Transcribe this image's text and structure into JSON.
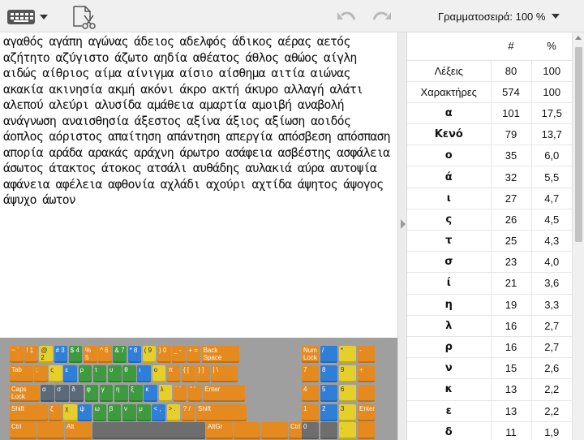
{
  "toolbar": {
    "keyboard_icon": "keyboard-icon",
    "clear_icon": "clear-text-icon",
    "undo_icon": "undo-icon",
    "redo_icon": "redo-icon",
    "font_size_label": "Γραμματοσειρά: 100 %"
  },
  "text": {
    "content": "αγαθός αγάπη αγώνας άδειος αδελφός άδικος αέρας αετός αζήτητο αζύγιστο άζωτο αηδία αθέατος άθλος αθώος αίγλη αιδώς αίθριος αίμα αίνιγμα αίσιο αίσθημα αιτία αιώνας ακακία ακινησία ακμή ακόνι άκρο ακτή άκυρο αλλαγή αλάτι αλεπού αλεύρι αλυσίδα αμάθεια αμαρτία αμοιβή αναβολή ανάγνωση αναισθησία άξεστος αξίνα άξιος αξίωση αοιδός άοπλος αόριστος απαίτηση απάντηση απεργία απόσβεση απόσπαση απορία αράδα αρακάς αράχνη άρωτρο ασάφεια ασβέστης ασφάλεια άσωτος άτακτος άτοκος ατσάλι αυθάδης αυλακιά αύρα αυτοψία αφάνεια αφέλεια αφθονία αχλάδι αχούρι αχτίδα άψητος άψογος άψυχο άωτον"
  },
  "stats": {
    "headers": [
      "",
      "#",
      "%"
    ],
    "rows": [
      {
        "label": "Λέξεις",
        "count": "80",
        "percent": "100"
      },
      {
        "label": "Χαρακτήρες",
        "count": "574",
        "percent": "100"
      },
      {
        "label": "α",
        "count": "101",
        "percent": "17,5"
      },
      {
        "label": "Κενό",
        "count": "79",
        "percent": "13,7"
      },
      {
        "label": "ο",
        "count": "35",
        "percent": "6,0"
      },
      {
        "label": "ά",
        "count": "32",
        "percent": "5,5"
      },
      {
        "label": "ι",
        "count": "27",
        "percent": "4,7"
      },
      {
        "label": "ς",
        "count": "26",
        "percent": "4,5"
      },
      {
        "label": "τ",
        "count": "25",
        "percent": "4,3"
      },
      {
        "label": "σ",
        "count": "23",
        "percent": "4,0"
      },
      {
        "label": "ί",
        "count": "21",
        "percent": "3,6"
      },
      {
        "label": "η",
        "count": "19",
        "percent": "3,3"
      },
      {
        "label": "λ",
        "count": "16",
        "percent": "2,7"
      },
      {
        "label": "ρ",
        "count": "16",
        "percent": "2,7"
      },
      {
        "label": "ν",
        "count": "15",
        "percent": "2,6"
      },
      {
        "label": "κ",
        "count": "13",
        "percent": "2,2"
      },
      {
        "label": "ε",
        "count": "13",
        "percent": "2,2"
      },
      {
        "label": "δ",
        "count": "11",
        "percent": "1,9"
      }
    ]
  },
  "keyboard": {
    "rows": [
      [
        {
          "l": "~ `",
          "c": "orange"
        },
        {
          "l": "! 1",
          "c": "orange"
        },
        {
          "l": "@ 2",
          "c": "yellow"
        },
        {
          "l": "# 3",
          "c": "blue"
        },
        {
          "l": "$ 4",
          "c": "green"
        },
        {
          "l": "% 5",
          "c": "orange"
        },
        {
          "l": "^ 6",
          "c": "orange"
        },
        {
          "l": "& 7",
          "c": "green"
        },
        {
          "l": "* 8",
          "c": "blue"
        },
        {
          "l": "( 9",
          "c": "yellow"
        },
        {
          "l": ") 0",
          "c": "orange"
        },
        {
          "l": "_ -",
          "c": "orange"
        },
        {
          "l": "+ =",
          "c": "orange"
        },
        {
          "l": "Back Space",
          "c": "orange",
          "w": 48
        }
      ],
      [
        {
          "l": "Tab",
          "c": "orange",
          "w": 30
        },
        {
          "l": ";",
          "c": "orange"
        },
        {
          "l": "ς",
          "c": "yellow"
        },
        {
          "l": "ε",
          "c": "blue"
        },
        {
          "l": "ρ",
          "c": "green"
        },
        {
          "l": "τ",
          "c": "green"
        },
        {
          "l": "υ",
          "c": "green"
        },
        {
          "l": "θ",
          "c": "green"
        },
        {
          "l": "ι",
          "c": "blue"
        },
        {
          "l": "ο",
          "c": "yellow"
        },
        {
          "l": "π",
          "c": "orange"
        },
        {
          "l": "{ [",
          "c": "orange"
        },
        {
          "l": "} ]",
          "c": "orange"
        },
        {
          "l": "| \\",
          "c": "orange",
          "w": 34
        }
      ],
      [
        {
          "l": "Caps Lock",
          "c": "orange",
          "w": 38
        },
        {
          "l": "α",
          "c": "shade"
        },
        {
          "l": "σ",
          "c": "shade"
        },
        {
          "l": "δ",
          "c": "shade"
        },
        {
          "l": "φ",
          "c": "green"
        },
        {
          "l": "γ",
          "c": "green"
        },
        {
          "l": "η",
          "c": "green"
        },
        {
          "l": "ξ",
          "c": "green"
        },
        {
          "l": "κ",
          "c": "blue"
        },
        {
          "l": "λ",
          "c": "yellow"
        },
        {
          "l": "΄ ¨",
          "c": "orange"
        },
        {
          "l": "\" '",
          "c": "orange"
        },
        {
          "l": "Enter",
          "c": "orange",
          "w": 53
        }
      ],
      [
        {
          "l": "Shift",
          "c": "orange",
          "w": 48
        },
        {
          "l": "ζ",
          "c": "orange"
        },
        {
          "l": "χ",
          "c": "yellow"
        },
        {
          "l": "ψ",
          "c": "blue"
        },
        {
          "l": "ω",
          "c": "green"
        },
        {
          "l": "β",
          "c": "green"
        },
        {
          "l": "ν",
          "c": "green"
        },
        {
          "l": "μ",
          "c": "green"
        },
        {
          "l": "< ,",
          "c": "blue"
        },
        {
          "l": "> .",
          "c": "yellow"
        },
        {
          "l": "? /",
          "c": "orange"
        },
        {
          "l": "Shift",
          "c": "orange",
          "w": 63
        }
      ],
      [
        {
          "l": "Ctrl",
          "c": "orange",
          "w": 34
        },
        {
          "l": "",
          "c": "orange",
          "w": 34
        },
        {
          "l": "Alt",
          "c": "orange",
          "w": 34
        },
        {
          "l": "",
          "c": "grey",
          "w": 140
        },
        {
          "l": "AltGr",
          "c": "orange",
          "w": 34
        },
        {
          "l": "",
          "c": "orange",
          "w": 34
        },
        {
          "l": "",
          "c": "orange",
          "w": 34
        },
        {
          "l": "Ctrl",
          "c": "orange",
          "w": 34
        }
      ]
    ],
    "numpad": [
      [
        {
          "l": "Num Lock",
          "c": "orange"
        },
        {
          "l": "/",
          "c": "blue"
        },
        {
          "l": "*",
          "c": "yellow"
        },
        {
          "l": "-",
          "c": "orange"
        }
      ],
      [
        {
          "l": "7",
          "c": "orange"
        },
        {
          "l": "8",
          "c": "blue"
        },
        {
          "l": "9",
          "c": "yellow"
        },
        {
          "l": "+",
          "c": "orange"
        }
      ],
      [
        {
          "l": "4",
          "c": "orange"
        },
        {
          "l": "5",
          "c": "blue"
        },
        {
          "l": "6",
          "c": "yellow"
        },
        {
          "l": "",
          "c": "orange"
        }
      ],
      [
        {
          "l": "1",
          "c": "orange"
        },
        {
          "l": "2",
          "c": "blue"
        },
        {
          "l": "3",
          "c": "yellow"
        },
        {
          "l": "Enter",
          "c": "orange"
        }
      ],
      [
        {
          "l": "0",
          "c": "grey"
        },
        {
          "l": "",
          "c": "grey"
        },
        {
          "l": ".",
          "c": "yellow"
        },
        {
          "l": "",
          "c": "orange"
        }
      ]
    ]
  }
}
